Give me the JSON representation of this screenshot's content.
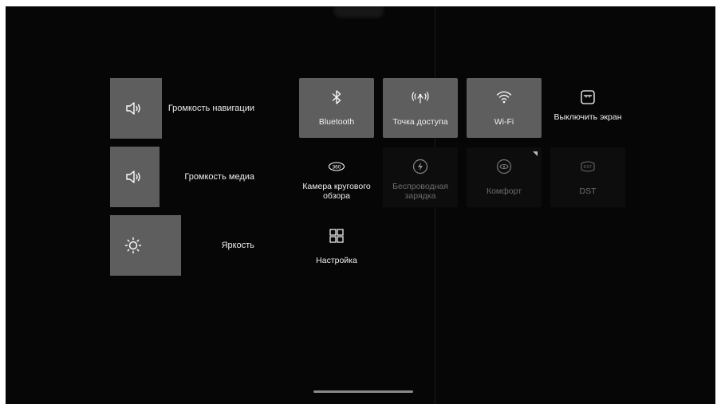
{
  "sliders": [
    {
      "label": "Громкость навигации",
      "icon": "speaker-icon",
      "level": 0.36
    },
    {
      "label": "Громкость медиа",
      "icon": "speaker-icon",
      "level": 0.34
    },
    {
      "label": "Яркость",
      "icon": "sun-icon",
      "level": 0.49
    }
  ],
  "tiles": {
    "bluetooth": {
      "label": "Bluetooth",
      "icon": "bluetooth-icon",
      "state": "on"
    },
    "hotspot": {
      "label": "Точка доступа",
      "icon": "hotspot-icon",
      "state": "on"
    },
    "wifi": {
      "label": "Wi-Fi",
      "icon": "wifi-icon",
      "state": "on"
    },
    "screen_off": {
      "label": "Выключить экран",
      "icon": "screen-off-icon",
      "state": "off"
    },
    "camera360": {
      "label": "Камера кругового обзора",
      "icon": "camera-360-icon",
      "state": "off"
    },
    "wireless_charging": {
      "label": "Беспроводная зарядка",
      "icon": "wireless-charging-icon",
      "state": "disabled"
    },
    "comfort": {
      "label": "Комфорт",
      "icon": "comfort-icon",
      "state": "disabled"
    },
    "dst": {
      "label": "DST",
      "icon": "dst-icon",
      "state": "disabled"
    },
    "settings": {
      "label": "Настройка",
      "icon": "grid-icon",
      "state": "off"
    }
  },
  "colors": {
    "background": "#060606",
    "tile_active": "#5e5e5e",
    "tile_disabled": "#0d0d0d",
    "text_disabled": "#6d6d6d"
  }
}
